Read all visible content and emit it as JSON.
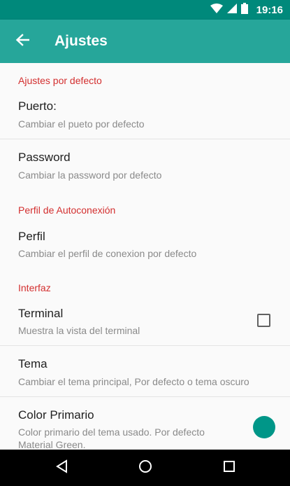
{
  "status_bar": {
    "time": "19:16",
    "icons": [
      "wifi-icon",
      "cell-signal-icon",
      "battery-icon"
    ]
  },
  "app_bar": {
    "title": "Ajustes",
    "back_icon": "arrow-left-icon"
  },
  "categories": {
    "default": "Ajustes por defecto",
    "autoconnect": "Perfil de Autoconexión",
    "interface": "Interfaz"
  },
  "prefs": {
    "port": {
      "title": "Puerto:",
      "summary": "Cambiar el pueto por defecto"
    },
    "password": {
      "title": "Password",
      "summary": "Cambiar la password por defecto"
    },
    "profile": {
      "title": "Perfil",
      "summary": "Cambiar el perfil de conexion por defecto"
    },
    "terminal": {
      "title": "Terminal",
      "summary": "Muestra la vista del terminal",
      "checked": false
    },
    "theme": {
      "title": "Tema",
      "summary": "Cambiar el tema principal, Por defecto o tema oscuro"
    },
    "primary_color": {
      "title": "Color Primario",
      "summary": "Color primario del tema usado. Por defecto Material Green.",
      "color": "#009688"
    }
  },
  "colors": {
    "status_bar": "#00897b",
    "app_bar": "#26a69a",
    "category_text": "#d32f2f",
    "accent": "#009688"
  },
  "nav_bar": {
    "buttons": [
      "back-triangle-icon",
      "home-circle-icon",
      "recents-square-icon"
    ]
  }
}
